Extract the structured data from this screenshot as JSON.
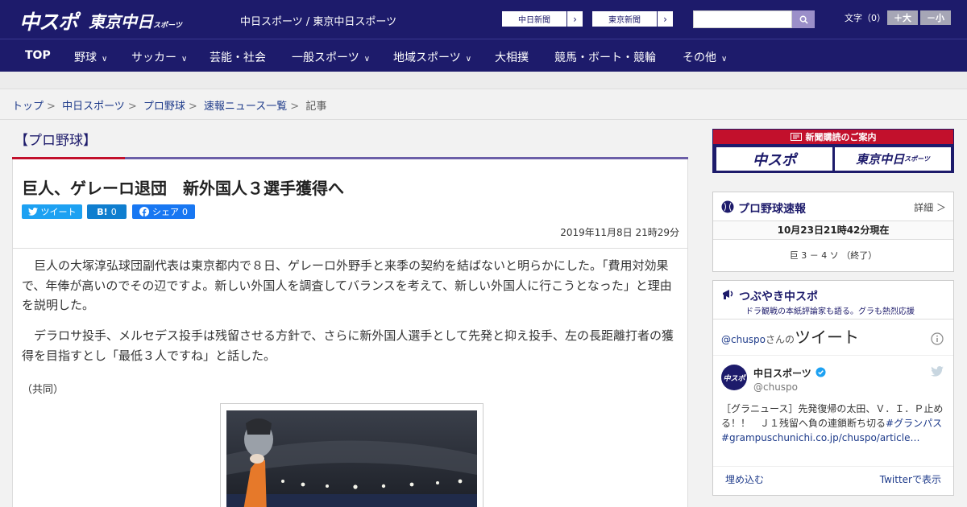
{
  "header": {
    "logo_primary": "中スポ",
    "logo_secondary": "東京中日",
    "logo_secondary_small": "スポーツ",
    "site_names": "中日スポーツ / 東京中日スポーツ",
    "paper_links": [
      "中日新聞",
      "東京新聞"
    ],
    "font_size_label": "文字（0）",
    "font_larger": "＋大",
    "font_smaller": "－小"
  },
  "nav": {
    "items": [
      {
        "label": "TOP",
        "dropdown": false
      },
      {
        "label": "野球",
        "dropdown": true
      },
      {
        "label": "サッカー",
        "dropdown": true
      },
      {
        "label": "芸能・社会",
        "dropdown": false
      },
      {
        "label": "一般スポーツ",
        "dropdown": true
      },
      {
        "label": "地域スポーツ",
        "dropdown": true
      },
      {
        "label": "大相撲",
        "dropdown": false
      },
      {
        "label": "競馬・ボート・競輪",
        "dropdown": false
      },
      {
        "label": "その他",
        "dropdown": true
      }
    ]
  },
  "breadcrumb": {
    "items": [
      "トップ",
      "中日スポーツ",
      "プロ野球",
      "速報ニュース一覧"
    ],
    "current": "記事"
  },
  "article": {
    "category": "【プロ野球】",
    "headline": "巨人、ゲレーロ退団　新外国人３選手獲得へ",
    "share": {
      "tweet_label": "ツイート",
      "hatena_label": "B!",
      "hatena_count": "0",
      "facebook_label": "シェア",
      "facebook_count": "0"
    },
    "date": "2019年11月8日 21時29分",
    "paragraphs": [
      "巨人の大塚淳弘球団副代表は東京都内で８日、ゲレーロ外野手と来季の契約を結ばないと明らかにした。「費用対効果で、年俸が高いのでその辺ですよ。新しい外国人を調査してバランスを考えて、新しい外国人に行こうとなった」と理由を説明した。",
      "デラロサ投手、メルセデス投手は残留させる方針で、さらに新外国人選手として先発と抑え投手、左の長距離打者の獲得を目指すとし「最低３人ですね」と話した。"
    ],
    "credit": "（共同）"
  },
  "sidebar": {
    "subscription": {
      "title": "新聞購読のご案内",
      "buttons": [
        "中スポ",
        "東京中日"
      ],
      "button_small": "スポーツ"
    },
    "baseball_bulletin": {
      "title": "プロ野球速報",
      "more": "詳細 ＞",
      "status": "10月23日21時42分現在",
      "score": "巨 3 － 4 ソ （終了）"
    },
    "tweets": {
      "title": "つぶやき中スポ",
      "subtitle": "ドラ観戦の本紙評論家も語る。グラも熱烈応援",
      "by_handle": "@chuspo",
      "by_suffix": "さんの",
      "tweets_label": "ツイート",
      "account_name": "中日スポーツ",
      "account_handle": "@chuspo",
      "avatar_text": "中スポ",
      "tweet_text": "［グラニュース］先発復帰の太田、Ｖ．Ｉ．Ｐ止める！！　Ｊ１残留へ負の連鎖断ち切る",
      "tweet_hashtag": "#グランパス",
      "tweet_link": "#grampuschunichi.co.jp/chuspo/article…",
      "embed_label": "埋め込む",
      "view_on_twitter": "Twitterで表示"
    }
  },
  "colors": {
    "brand_navy": "#1d1b6b",
    "accent_red": "#c2102c",
    "accent_purple": "#6c5fa8",
    "twitter_blue": "#1da1f2"
  }
}
